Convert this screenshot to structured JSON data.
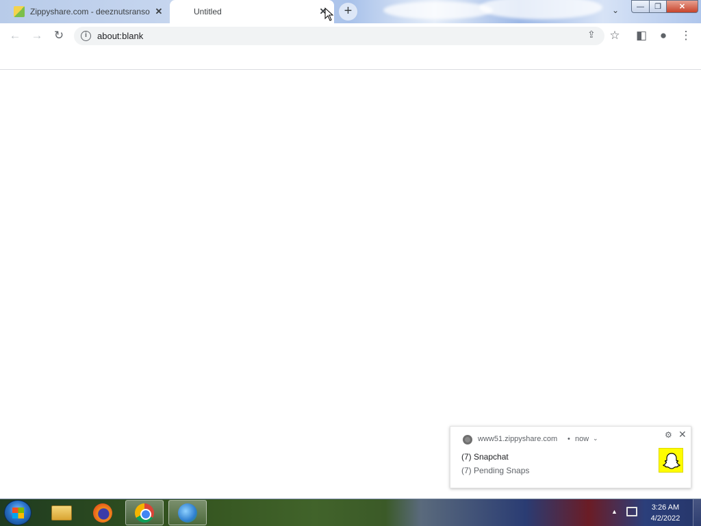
{
  "browser": {
    "tabs": [
      {
        "title": "Zippyshare.com - deeznutsranso",
        "active": false,
        "favicon": "zippyshare-favicon"
      },
      {
        "title": "Untitled",
        "active": true
      }
    ],
    "tab_close_glyph": "✕",
    "new_tab_glyph": "+",
    "tab_search_glyph": "⌄",
    "window_controls": {
      "minimize": "—",
      "maximize": "❐",
      "close": "✕"
    }
  },
  "toolbar": {
    "back_glyph": "←",
    "forward_glyph": "→",
    "reload_glyph": "↻",
    "info_glyph": "i",
    "url": "about:blank",
    "share_glyph": "⇪",
    "bookmark_glyph": "☆",
    "side_panel_glyph": "◧",
    "profile_glyph": "●",
    "menu_glyph": "⋮"
  },
  "notification": {
    "origin": "www51.zippyshare.com",
    "separator": "•",
    "time": "now",
    "chevron": "⌄",
    "settings_glyph": "⚙",
    "close_glyph": "✕",
    "title": "(7) Snapchat",
    "body": "(7) Pending Snaps",
    "icon_color": "#fffc00"
  },
  "taskbar": {
    "apps": [
      "windows-explorer",
      "firefox",
      "chrome",
      "internet-download-manager"
    ],
    "active_app": "chrome",
    "tray_arrow": "▲",
    "clock_time": "3:26 AM",
    "clock_date": "4/2/2022"
  }
}
